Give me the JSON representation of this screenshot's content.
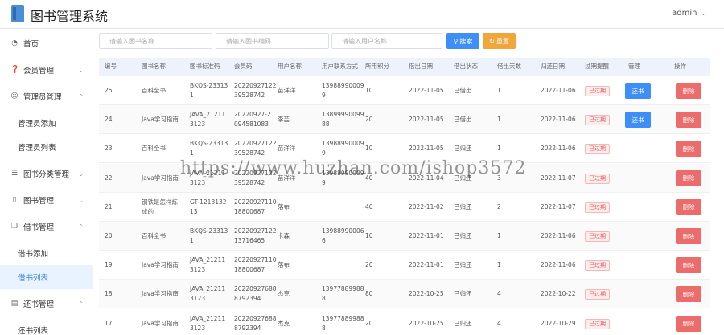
{
  "header": {
    "title": "图书管理系统",
    "user": "admin"
  },
  "sidebar": {
    "items": [
      {
        "label": "首页",
        "icon": "dashboard-icon",
        "has_children": false
      },
      {
        "label": "会员管理",
        "icon": "help-circle-icon",
        "has_children": true,
        "expanded": false
      },
      {
        "label": "管理员管理",
        "icon": "user-icon",
        "has_children": true,
        "expanded": true,
        "children": [
          {
            "label": "管理员添加"
          },
          {
            "label": "管理员列表"
          }
        ]
      },
      {
        "label": "图书分类管理",
        "icon": "sliders-icon",
        "has_children": true,
        "expanded": false
      },
      {
        "label": "图书管理",
        "icon": "book-icon",
        "has_children": true,
        "expanded": false
      },
      {
        "label": "借书管理",
        "icon": "copy-icon",
        "has_children": true,
        "expanded": true,
        "children": [
          {
            "label": "借书添加"
          },
          {
            "label": "借书列表",
            "active": true
          }
        ]
      },
      {
        "label": "还书管理",
        "icon": "document-icon",
        "has_children": true,
        "expanded": true,
        "children": [
          {
            "label": "还书列表"
          }
        ]
      }
    ]
  },
  "filters": {
    "book_name_placeholder": "请输入图书名称",
    "book_code_placeholder": "请输入图书编码",
    "user_name_placeholder": "请输入用户名称",
    "search_label": "搜索",
    "reset_label": "重置"
  },
  "table": {
    "headers": [
      "编号",
      "图书名称",
      "图书标准码",
      "会员码",
      "用户名称",
      "用户联系方式",
      "所用积分",
      "借出日期",
      "借出状态",
      "借出天数",
      "归还日期",
      "过期提醒",
      "管理",
      "操作"
    ],
    "rows": [
      {
        "id": "25",
        "book": [
          "百科全书"
        ],
        "code": [
          "BKQS-23313",
          "1"
        ],
        "member": [
          "20220927122",
          "39528742"
        ],
        "user": "苗洋洋",
        "phone": [
          "13988990009",
          "9"
        ],
        "points": "10",
        "date": "2022-11-05",
        "status": "已借出",
        "days": "1",
        "return_date": "2022-11-06",
        "overdue": "已过期",
        "manage": "还书",
        "action": "删除"
      },
      {
        "id": "24",
        "book": [
          "Java学习指南"
        ],
        "code": [
          "JAVA_21211",
          "3123"
        ],
        "member": [
          "20220927-2",
          "094581083"
        ],
        "user": "李芸",
        "phone": [
          "13899990099",
          "88"
        ],
        "points": "20",
        "date": "2022-11-05",
        "status": "已借出",
        "days": "1",
        "return_date": "2022-11-06",
        "overdue": "已过期",
        "manage": "还书",
        "action": "删除"
      },
      {
        "id": "23",
        "book": [
          "百科全书"
        ],
        "code": [
          "BKQS-23313",
          "1"
        ],
        "member": [
          "20220927122",
          "39528742"
        ],
        "user": "苗洋洋",
        "phone": [
          "13988990009",
          "9"
        ],
        "points": "10",
        "date": "2022-11-05",
        "status": "已归还",
        "days": "1",
        "return_date": "2022-11-06",
        "overdue": "已过期",
        "manage": "",
        "action": "删除"
      },
      {
        "id": "22",
        "book": [
          "Java学习指南"
        ],
        "code": [
          "JAVA_21211",
          "3123"
        ],
        "member": [
          "20220927122",
          "39528742"
        ],
        "user": "苗洋洋",
        "phone": [
          "13988990009",
          "9"
        ],
        "points": "40",
        "date": "2022-11-04",
        "status": "已归还",
        "days": "3",
        "return_date": "2022-11-07",
        "overdue": "已过期",
        "manage": "",
        "action": "删除"
      },
      {
        "id": "21",
        "book": [
          "钢铁是怎样炼",
          "成的"
        ],
        "code": [
          "GT-1213132",
          "13"
        ],
        "member": [
          "20220927110",
          "18800687"
        ],
        "user": "落布",
        "phone": [
          "",
          ""
        ],
        "points": "40",
        "date": "2022-11-02",
        "status": "已归还",
        "days": "2",
        "return_date": "2022-11-07",
        "overdue": "已过期",
        "manage": "",
        "action": "删除"
      },
      {
        "id": "20",
        "book": [
          "百科全书"
        ],
        "code": [
          "BKQS-23313",
          "1"
        ],
        "member": [
          "20220927122",
          "13716465"
        ],
        "user": "卡森",
        "phone": [
          "13988990006",
          "6"
        ],
        "points": "10",
        "date": "2022-11-01",
        "status": "已归还",
        "days": "1",
        "return_date": "2022-11-06",
        "overdue": "已过期",
        "manage": "",
        "action": "删除"
      },
      {
        "id": "19",
        "book": [
          "Java学习指南"
        ],
        "code": [
          "JAVA_21211",
          "3123"
        ],
        "member": [
          "20220927110",
          "18800687"
        ],
        "user": "落布",
        "phone": [
          "",
          ""
        ],
        "points": "20",
        "date": "2022-11-01",
        "status": "已归还",
        "days": "1",
        "return_date": "2022-11-06",
        "overdue": "已过期",
        "manage": "",
        "action": "删除"
      },
      {
        "id": "18",
        "book": [
          "Java学习指南"
        ],
        "code": [
          "JAVA_21211",
          "3123"
        ],
        "member": [
          "20220927688",
          "8792394"
        ],
        "user": "杰克",
        "phone": [
          "13977889988",
          "8"
        ],
        "points": "80",
        "date": "2022-10-25",
        "status": "已归还",
        "days": "4",
        "return_date": "2022-10-22",
        "overdue": "已过期",
        "manage": "",
        "action": "删除"
      },
      {
        "id": "17",
        "book": [
          "Java学习指南"
        ],
        "code": [
          "JAVA_21211",
          "3123"
        ],
        "member": [
          "20220927688",
          "8792394"
        ],
        "user": "杰克",
        "phone": [
          "13977889988",
          "8"
        ],
        "points": "20",
        "date": "2022-10-25",
        "status": "已归还",
        "days": "4",
        "return_date": "2022-10-29",
        "overdue": "已过期",
        "manage": "",
        "action": "删除"
      }
    ]
  },
  "watermark": "https://www.huzhan.com/ishop3572",
  "colors": {
    "primary": "#3d8ef7",
    "warning": "#f0a63a",
    "danger": "#ec6b6b",
    "active_bg": "#e8f3ff"
  }
}
